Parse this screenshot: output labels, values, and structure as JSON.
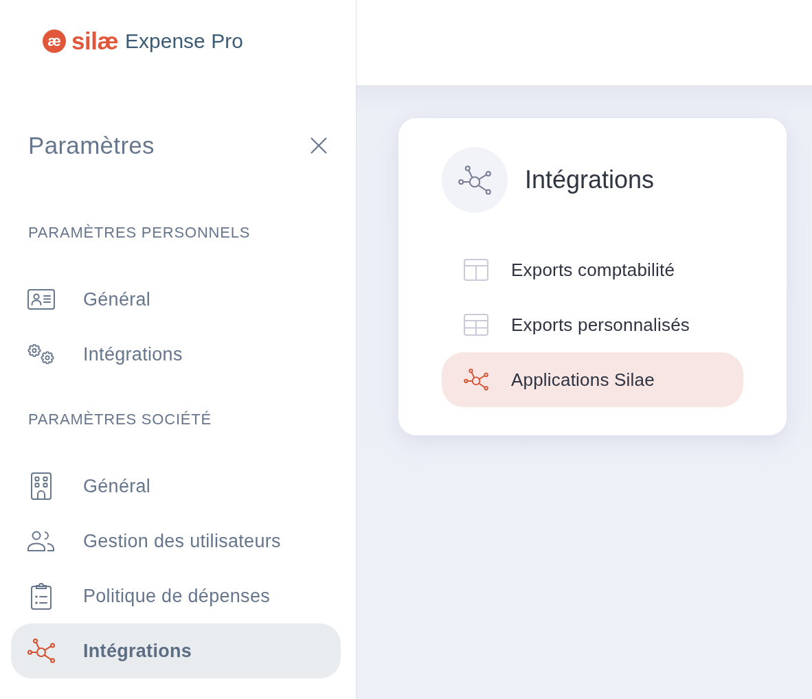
{
  "logo": {
    "mark": "æ",
    "brand": "silæ",
    "product": "Expense Pro"
  },
  "sidebar": {
    "title": "Paramètres",
    "sections": [
      {
        "heading": "PARAMÈTRES PERSONNELS",
        "items": [
          {
            "label": "Général",
            "selected": false
          },
          {
            "label": "Intégrations",
            "selected": false
          }
        ]
      },
      {
        "heading": "PARAMÈTRES SOCIÉTÉ",
        "items": [
          {
            "label": "Général",
            "selected": false
          },
          {
            "label": "Gestion des utilisateurs",
            "selected": false
          },
          {
            "label": "Politique de dépenses",
            "selected": false
          },
          {
            "label": "Intégrations",
            "selected": true
          }
        ]
      }
    ]
  },
  "panel": {
    "title": "Intégrations",
    "items": [
      {
        "label": "Exports comptabilité",
        "selected": false
      },
      {
        "label": "Exports personnalisés",
        "selected": false
      },
      {
        "label": "Applications Silae",
        "selected": true
      }
    ]
  }
}
